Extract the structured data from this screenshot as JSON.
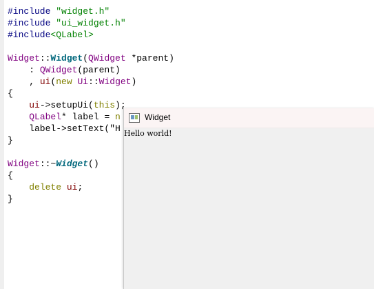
{
  "editor": {
    "lines": [
      [
        {
          "t": "#include ",
          "c": "pp"
        },
        {
          "t": "\"widget.h\"",
          "c": "str"
        }
      ],
      [
        {
          "t": "#include ",
          "c": "pp"
        },
        {
          "t": "\"ui_widget.h\"",
          "c": "str"
        }
      ],
      [
        {
          "t": "#include",
          "c": "pp"
        },
        {
          "t": "<QLabel>",
          "c": "str"
        }
      ],
      [],
      [
        {
          "t": "Widget",
          "c": "cls"
        },
        {
          "t": "::",
          "c": "plain"
        },
        {
          "t": "Widget",
          "c": "fn"
        },
        {
          "t": "(",
          "c": "plain"
        },
        {
          "t": "QWidget",
          "c": "cls"
        },
        {
          "t": " *parent)",
          "c": "plain"
        }
      ],
      [
        {
          "t": "    : ",
          "c": "plain"
        },
        {
          "t": "QWidget",
          "c": "cls"
        },
        {
          "t": "(parent)",
          "c": "plain"
        }
      ],
      [
        {
          "t": "    , ",
          "c": "plain"
        },
        {
          "t": "ui",
          "c": "mem"
        },
        {
          "t": "(",
          "c": "plain"
        },
        {
          "t": "new",
          "c": "kw"
        },
        {
          "t": " ",
          "c": "plain"
        },
        {
          "t": "Ui",
          "c": "cls"
        },
        {
          "t": "::",
          "c": "plain"
        },
        {
          "t": "Widget",
          "c": "cls"
        },
        {
          "t": ")",
          "c": "plain"
        }
      ],
      [
        {
          "t": "{",
          "c": "plain"
        }
      ],
      [
        {
          "t": "    ",
          "c": "plain"
        },
        {
          "t": "ui",
          "c": "mem"
        },
        {
          "t": "->setupUi(",
          "c": "plain"
        },
        {
          "t": "this",
          "c": "kw"
        },
        {
          "t": ");",
          "c": "plain"
        }
      ],
      [
        {
          "t": "    ",
          "c": "plain"
        },
        {
          "t": "QLabel",
          "c": "cls"
        },
        {
          "t": "* label = ",
          "c": "plain"
        },
        {
          "t": "n",
          "c": "kw"
        }
      ],
      [
        {
          "t": "    label->setText(\"H",
          "c": "plain"
        }
      ],
      [
        {
          "t": "}",
          "c": "plain"
        }
      ],
      [],
      [
        {
          "t": "Widget",
          "c": "cls"
        },
        {
          "t": "::~",
          "c": "plain"
        },
        {
          "t": "Widget",
          "c": "fn-it"
        },
        {
          "t": "()",
          "c": "plain"
        }
      ],
      [
        {
          "t": "{",
          "c": "plain"
        }
      ],
      [
        {
          "t": "    ",
          "c": "plain"
        },
        {
          "t": "delete",
          "c": "kw"
        },
        {
          "t": " ",
          "c": "plain"
        },
        {
          "t": "ui",
          "c": "mem"
        },
        {
          "t": ";",
          "c": "plain"
        }
      ],
      [
        {
          "t": "}",
          "c": "plain"
        }
      ]
    ]
  },
  "app_window": {
    "title": "Widget",
    "icon": "qt-window-icon",
    "label_text": "Hello world!"
  }
}
